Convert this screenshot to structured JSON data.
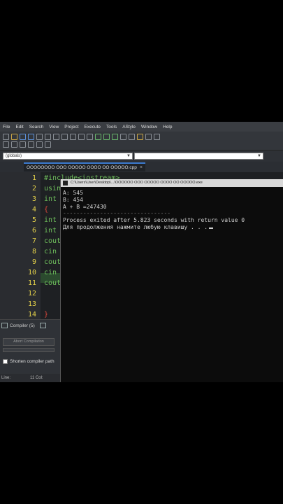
{
  "menu": [
    "File",
    "Edit",
    "Search",
    "View",
    "Project",
    "Execute",
    "Tools",
    "AStyle",
    "Window",
    "Help"
  ],
  "combo_scope": "(globals)",
  "file_tab": {
    "label": "ОООООООО ООО ООООО ОООО ОО ООООО.cpp",
    "close": "×"
  },
  "line_numbers": [
    "1",
    "2",
    "3",
    "4",
    "5",
    "6",
    "7",
    "8",
    "9",
    "10",
    "11",
    "12",
    "13",
    "14"
  ],
  "code_lines": [
    "#include<iostream>",
    "using",
    "int",
    "{",
    "int",
    "int",
    "cout",
    "cin",
    "cout",
    "cin",
    "cout",
    "",
    "",
    "}"
  ],
  "bottom": {
    "compiler_tab": "Compiler (5)",
    "abort": "Abort Compilation",
    "shorten": "Shorten compiler path"
  },
  "status": {
    "line": "Line:",
    "col": "11 Col:"
  },
  "console": {
    "title": "C:\\Users\\User\\Desktop\\...\\ОООООО ООО ООООО ОООО ОО ООООО.exe",
    "lines": [
      "A: 545",
      "B: 454",
      "A + B =247430",
      "--------------------------------",
      "Process exited after 5.823 seconds with return value 0",
      "Для продолжения нажмите любую клавишу . . ."
    ]
  }
}
